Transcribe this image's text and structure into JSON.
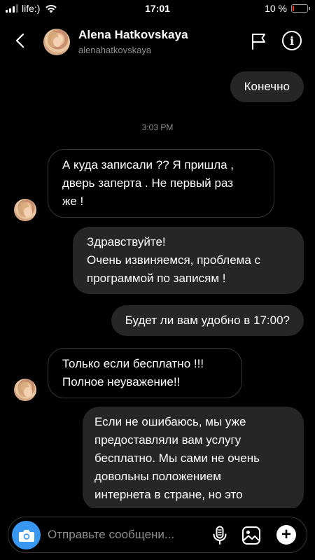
{
  "status_bar": {
    "carrier": "life:)",
    "time": "17:01",
    "battery": "10 %",
    "battery_level": 0.1
  },
  "header": {
    "name": "Alena Hatkovskaya",
    "username": "alenahatkovskaya"
  },
  "messages": [
    {
      "direction": "out",
      "lines": [
        "Конечно"
      ]
    },
    {
      "direction": "timestamp",
      "lines": [
        "3:03 PM"
      ]
    },
    {
      "direction": "in",
      "lines": [
        "А куда записали ?? Я пришла ,",
        "дверь заперта . Не первый раз",
        "же !"
      ]
    },
    {
      "direction": "out",
      "lines": [
        "Здравствуйте!",
        "Очень извиняемся, проблема с",
        "программой по записям !"
      ]
    },
    {
      "direction": "out",
      "lines": [
        "Будет ли вам удобно в 17:00?"
      ]
    },
    {
      "direction": "in",
      "lines": [
        "Только если бесплатно !!!",
        "Полное неуважение!!"
      ]
    },
    {
      "direction": "out",
      "lines": [
        "Если не ошибаюсь, мы уже",
        "предоставляли вам услугу",
        "бесплатно. Мы сами не очень",
        "довольны положением",
        "интернета в стране, но это"
      ]
    }
  ],
  "composer": {
    "placeholder": "Отправьте сообщени..."
  },
  "colors": {
    "background": "#000000",
    "outgoing_bubble": "#262626",
    "incoming_border": "#363636",
    "camera_button": "#3897f0",
    "secondary_text": "#8e8e8e",
    "battery_low": "#ff3b30"
  },
  "icons": [
    "back-chevron-icon",
    "flag-icon",
    "info-icon",
    "camera-icon",
    "microphone-icon",
    "gallery-icon",
    "plus-icon",
    "wifi-icon",
    "signal-icon",
    "battery-icon"
  ]
}
